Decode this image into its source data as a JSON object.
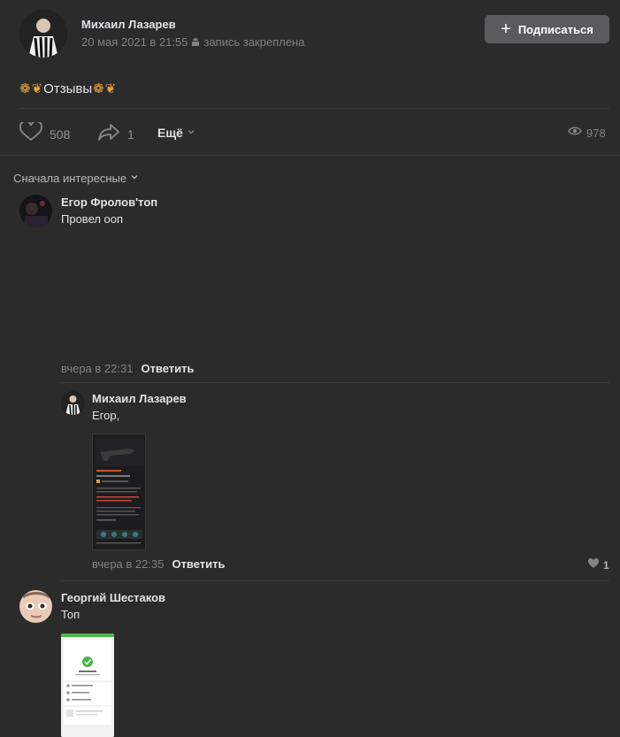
{
  "post": {
    "author": "Михаил Лазарев",
    "date": "20 мая 2021 в 21:55",
    "pinned": "запись закреплена",
    "subscribe_label": "Подписаться",
    "text": "Отзывы",
    "likes": "508",
    "shares": "1",
    "more_label": "Ещё",
    "views": "978"
  },
  "comments_sort": "Сначала интересные",
  "comments": [
    {
      "author": "Егор Фролов'топ",
      "text": "Провел ооп",
      "time": "вчера в 22:31",
      "reply_label": "Ответить"
    },
    {
      "author": "Михаил Лазарев",
      "text": "Егор,",
      "time": "вчера в 22:35",
      "reply_label": "Ответить",
      "likes": "1"
    },
    {
      "author": "Георгий Шестаков",
      "text": "Топ"
    }
  ],
  "colors": {
    "background": "#2b2b2c",
    "accent_orange": "#e8a33a",
    "success_green": "#4bb34b"
  }
}
